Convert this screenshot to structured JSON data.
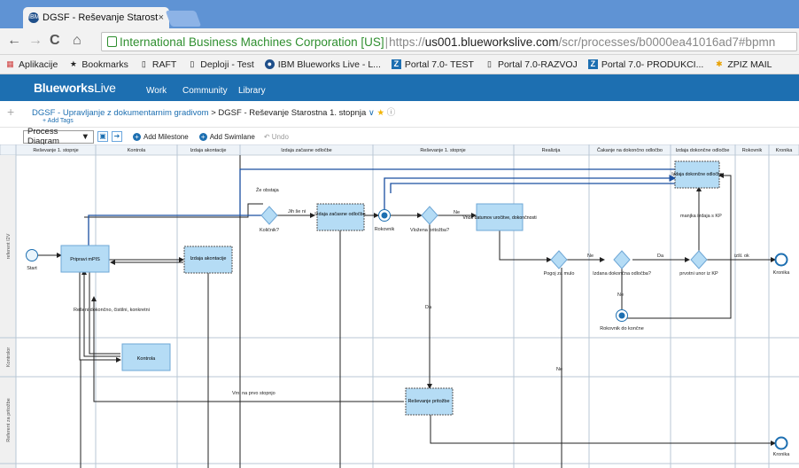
{
  "browser": {
    "tab_title": "DGSF - Reševanje Starostna",
    "tab_close": "×",
    "favicon": "IBM",
    "nav": {
      "back": "←",
      "forward": "→",
      "reload": "C",
      "home": "⌂"
    },
    "omnibox": {
      "secure_label": "International Business Machines Corporation [US]",
      "scheme": "https://",
      "host": "us001.blueworkslive.com",
      "path": "/scr/processes/b0000ea41016ad7#bpmn"
    },
    "bookmarks": [
      {
        "label": "Aplikacije",
        "icon": "apps-icon"
      },
      {
        "label": "Bookmarks",
        "icon": "star-icon"
      },
      {
        "label": "RAFT",
        "icon": "page-icon"
      },
      {
        "label": "Deploji - Test",
        "icon": "page-icon"
      },
      {
        "label": "IBM Blueworks Live - L...",
        "icon": "ibm-icon"
      },
      {
        "label": "Portal 7.0- TEST",
        "icon": "z-icon"
      },
      {
        "label": "Portal 7.0-RAZVOJ",
        "icon": "page-icon"
      },
      {
        "label": "Portal 7.0- PRODUKCI...",
        "icon": "z-icon"
      },
      {
        "label": "ZPIZ MAIL",
        "icon": "mail-icon"
      }
    ]
  },
  "app": {
    "brand_bold": "Blueworks",
    "brand_light": "Live",
    "nav": [
      "Work",
      "Community",
      "Library"
    ],
    "breadcrumb": {
      "parent": "DGSF - Upravljanje z dokumentarnim gradivom",
      "separator": ">",
      "current": "DGSF - Reševanje Starostna 1. stopnja",
      "menu": "∨",
      "star": "★",
      "info": "ⓘ",
      "add_tags": "+ Add Tags"
    },
    "toolbar": {
      "view_select": "Process Diagram",
      "add_milestone": "Add Milestone",
      "add_swimlane": "Add Swimlane",
      "undo": "Undo"
    }
  },
  "diagram": {
    "milestones": [
      "Reševanje 1. stopnje",
      "Kontrola",
      "Izdaja akontacije",
      "Izdaja začasne odločbe",
      "Reševanje 1. stopnje",
      "Realizija",
      "Čakanje na dokončno odločbo",
      "Izdaja dokončne odločbe",
      "Rokovnik",
      "Kronika"
    ],
    "lanes": [
      "referent I2V",
      "Kontrolor",
      "Referent za pritožbe"
    ],
    "tasks": {
      "pripravi": "Pripravi mPIS",
      "akontacija": "Izdaja akontacije",
      "kontrola": "Kontrola",
      "zacasna": "Izdaja začasne odločbe",
      "vnos": "Vnos datumov uročitve, dokončnosti",
      "dokoncna": "Izdaja dokončne odločbe",
      "pritozbe": "Reševanje pritožbe"
    },
    "events": {
      "start": "Start",
      "end1": "Kronika",
      "end2": "Kronika",
      "rok1": "Rokovnik",
      "rok2": "Rokovnik do končne"
    },
    "gateways": {
      "g1": "Količnik?",
      "g2": "Vložena pritožba?",
      "g3": "Pogoj za mulo",
      "g4": "Izdana dokončna odločba?",
      "g5": "prvotni unor iz KP"
    },
    "labels": {
      "ze_obstaja": "Že obstaja",
      "jih_se_ni": "Jih še ni",
      "ne1": "Ne",
      "da1": "Da",
      "ne2": "Ne",
      "ne3": "Ne",
      "da2": "Da",
      "ne4": "Ne",
      "ne5": "Ne",
      "manjka": "manjka izdaja s KP",
      "izsl": "izšl. ok",
      "reseni": "Rešeni dokončno, čistilni, konkretni",
      "vrni": "Vrni na prvo stopnjo"
    }
  }
}
